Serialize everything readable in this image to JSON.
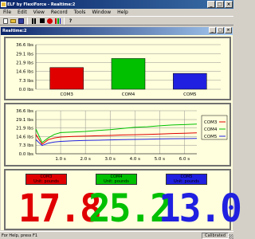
{
  "app": {
    "title": "ELF by FlexiForce - Realtime:2"
  },
  "menu": {
    "items": [
      "File",
      "Edit",
      "View",
      "Record",
      "Tools",
      "Window",
      "Help"
    ]
  },
  "toolbar": {
    "icons": [
      "new-icon",
      "open-icon",
      "save-icon",
      "pause-icon",
      "stop-icon",
      "record-icon",
      "bar-graph-icon",
      "help-icon"
    ],
    "help_label": "?"
  },
  "child_window": {
    "title": "Realtime:2"
  },
  "bar_chart": {
    "chart_data": {
      "type": "bar",
      "categories": [
        "COM3",
        "COM4",
        "COM5"
      ],
      "values": [
        17.8,
        25.2,
        13.0
      ],
      "colors": [
        "#e00000",
        "#00c000",
        "#2020e0"
      ],
      "ylim": [
        0,
        36.6
      ],
      "yticks": [
        0,
        7.3,
        14.6,
        21.9,
        29.1,
        36.6
      ],
      "ytick_labels": [
        "0.0 lbs",
        "7.3 lbs",
        "14.6 lbs",
        "21.9 lbs",
        "29.1 lbs",
        "36.6 lbs"
      ],
      "grid": true
    }
  },
  "line_chart": {
    "chart_data": {
      "type": "line",
      "ylim": [
        0,
        36.6
      ],
      "yticks": [
        0,
        7.3,
        14.6,
        21.9,
        29.1,
        36.6
      ],
      "ytick_labels": [
        "0.0 lbs",
        "7.3 lbs",
        "14.6 lbs",
        "21.9 lbs",
        "29.1 lbs",
        "36.6 lbs"
      ],
      "xlim": [
        0,
        6.5
      ],
      "xticks": [
        1,
        2,
        3,
        4,
        5,
        6
      ],
      "xtick_labels": [
        "1.0 s",
        "2.0 s",
        "3.0 s",
        "4.0 s",
        "5.0 s",
        "6.0 s"
      ],
      "x": [
        0,
        0.25,
        0.5,
        0.75,
        1,
        1.5,
        2,
        2.5,
        3,
        3.5,
        4,
        4.5,
        5,
        5.5,
        6,
        6.5
      ],
      "series": [
        {
          "name": "COM3",
          "color": "#e00000",
          "values": [
            16.5,
            8.0,
            12.0,
            13.5,
            14.2,
            14.8,
            15.0,
            15.3,
            15.6,
            16.0,
            16.2,
            16.5,
            16.8,
            17.2,
            17.5,
            17.8
          ]
        },
        {
          "name": "COM4",
          "color": "#00c000",
          "values": [
            21.0,
            9.5,
            13.5,
            16.5,
            18.0,
            18.5,
            19.0,
            19.8,
            20.5,
            21.5,
            22.5,
            23.0,
            23.8,
            24.5,
            24.8,
            25.2
          ]
        },
        {
          "name": "COM5",
          "color": "#2020e0",
          "values": [
            12.0,
            7.0,
            9.0,
            10.0,
            10.5,
            11.0,
            11.3,
            11.5,
            11.8,
            12.0,
            12.2,
            12.4,
            12.6,
            12.8,
            12.9,
            13.0
          ]
        }
      ],
      "legend_position": "right",
      "grid": true
    }
  },
  "readouts": [
    {
      "name": "COM3",
      "unit": "Unit: pounds",
      "value": "17.8",
      "color": "#e00000"
    },
    {
      "name": "COM4",
      "unit": "Unit: pounds",
      "value": "25.2",
      "color": "#00c000"
    },
    {
      "name": "COM5",
      "unit": "Unit: pounds",
      "value": "13.0",
      "color": "#2020e0"
    }
  ],
  "status": {
    "left": "For Help, press F1",
    "right": "Calibrated"
  }
}
